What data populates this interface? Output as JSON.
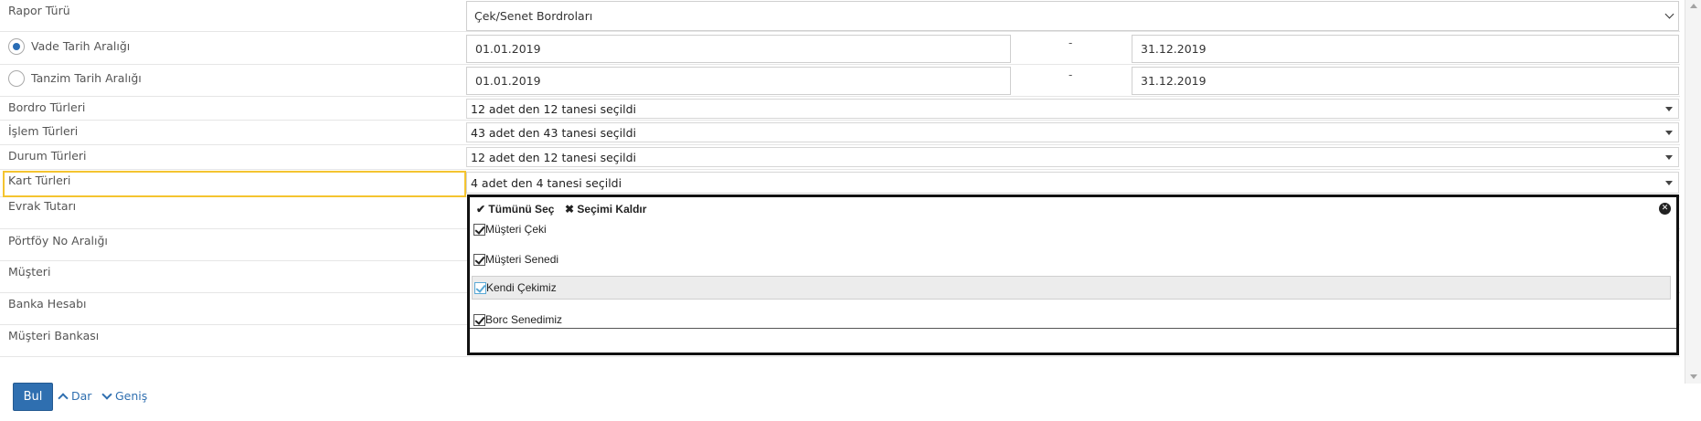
{
  "form": {
    "report_type": {
      "label": "Rapor Türü",
      "value": "Çek/Senet Bordroları"
    },
    "due_range": {
      "label": "Vade Tarih Aralığı",
      "from": "01.01.2019",
      "separator": "-",
      "to": "31.12.2019",
      "selected": true
    },
    "issue_range": {
      "label": "Tanzim Tarih Aralığı",
      "from": "01.01.2019",
      "separator": "-",
      "to": "31.12.2019",
      "selected": false
    },
    "payroll_types": {
      "label": "Bordro Türleri",
      "value": "12 adet den 12 tanesi seçildi"
    },
    "transaction_types": {
      "label": "İşlem Türleri",
      "value": "43 adet den 43 tanesi seçildi"
    },
    "status_types": {
      "label": "Durum Türleri",
      "value": "12 adet den 12 tanesi seçildi"
    },
    "card_types": {
      "label": "Kart Türleri",
      "value": "4 adet den 4 tanesi seçildi"
    },
    "document_amount": {
      "label": "Evrak Tutarı"
    },
    "portfolio_range": {
      "label": "Pörtföy No Aralığı"
    },
    "customer": {
      "label": "Müşteri"
    },
    "bank_account": {
      "label": "Banka Hesabı"
    },
    "customer_bank": {
      "label": "Müşteri Bankası"
    }
  },
  "dropdown": {
    "select_all": "Tümünü Seç",
    "clear_selection": "Seçimi Kaldır",
    "options": [
      {
        "label": "Müşteri Çeki",
        "checked": true
      },
      {
        "label": "Müşteri Senedi",
        "checked": true
      },
      {
        "label": "Kendi Çekimiz",
        "checked": true
      },
      {
        "label": "Borc Senedimiz",
        "checked": true
      }
    ]
  },
  "actions": {
    "search_label": "Bul",
    "collapse_label": "Dar",
    "expand_label": "Geniş"
  },
  "colors": {
    "primary_button": "#2f6fb0",
    "focus_highlight": "#f4c430"
  },
  "icons": {
    "checkmark": "check-icon",
    "clear": "x-icon",
    "close": "close-circle-icon",
    "collapse": "chevron-up-icon",
    "expand": "chevron-down-icon"
  }
}
